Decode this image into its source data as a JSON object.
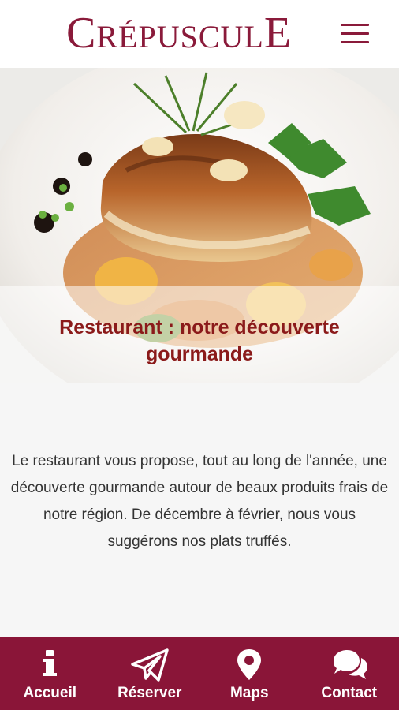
{
  "header": {
    "logo": {
      "part1": "C",
      "part2": "RÉPUSCUL",
      "part3": "E"
    },
    "menu_icon": "hamburger-menu-icon"
  },
  "hero": {
    "title": "Restaurant : notre découverte gourmande"
  },
  "intro": {
    "text": "Le restaurant vous propose, tout au long de l'année, une découverte gourmande autour de beaux produits frais de notre région. De décembre à février, nous vous suggérons nos plats truffés."
  },
  "bottom_nav": {
    "items": [
      {
        "label": "Accueil",
        "icon": "info-icon"
      },
      {
        "label": "Réserver",
        "icon": "paper-plane-icon"
      },
      {
        "label": "Maps",
        "icon": "map-pin-icon"
      },
      {
        "label": "Contact",
        "icon": "chat-bubbles-icon"
      }
    ]
  },
  "colors": {
    "brand": "#8a1a3a",
    "footer_bg": "#8a1538",
    "title": "#8b1a1a"
  }
}
